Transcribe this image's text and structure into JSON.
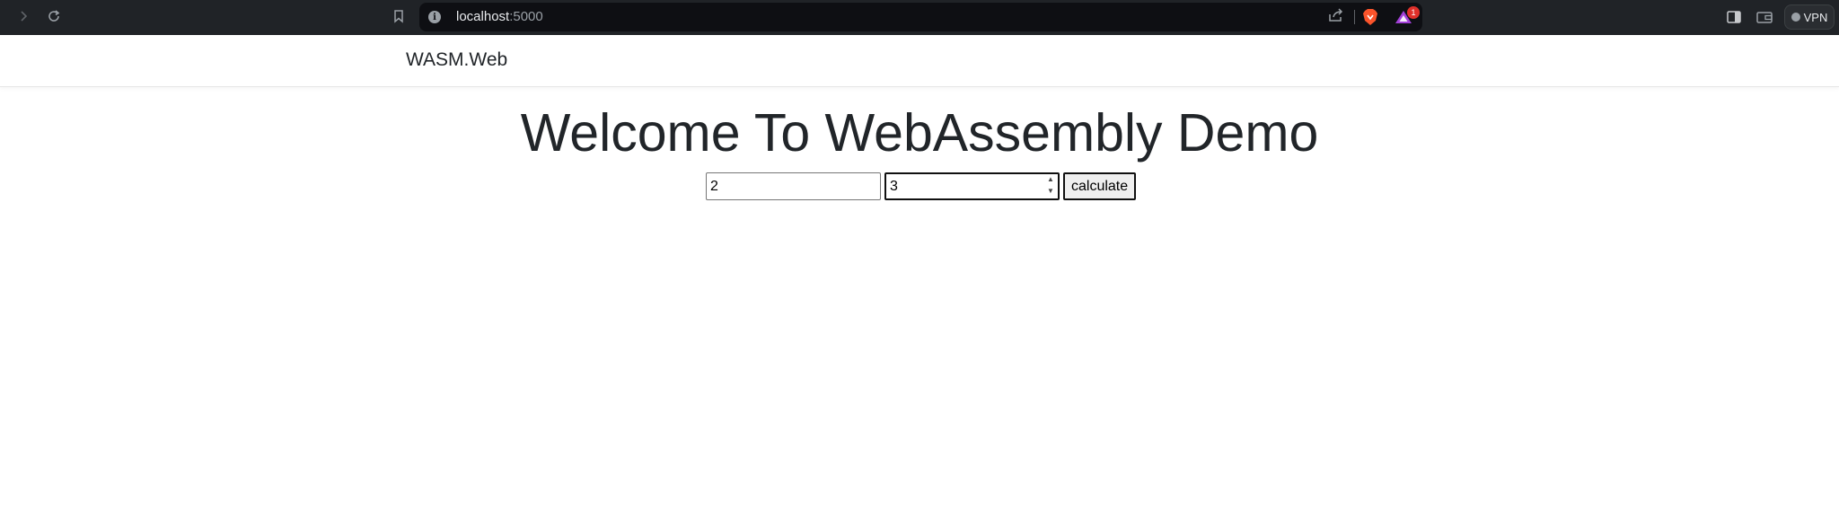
{
  "browser": {
    "url_host": "localhost",
    "url_port": ":5000",
    "rewards_badge": "1",
    "vpn_label": "VPN",
    "icons": {
      "forward": "chevron-right-icon",
      "reload": "reload-icon",
      "bookmark": "bookmark-icon",
      "site_info": "info-icon",
      "share": "share-icon",
      "shield": "brave-shield-icon",
      "rewards": "rewards-triangle-icon",
      "sidebar": "sidebar-toggle-icon",
      "wallet": "wallet-icon"
    },
    "colors": {
      "chrome_bg": "#202327",
      "urlbar_bg": "#0e0f13",
      "shield": "#fb542b",
      "badge": "#e0302a"
    }
  },
  "navbar": {
    "brand": "WASM.Web"
  },
  "main": {
    "heading": "Welcome To WebAssembly Demo",
    "input_a": {
      "value": "2"
    },
    "input_b": {
      "value": "3"
    },
    "calculate_label": "calculate"
  }
}
